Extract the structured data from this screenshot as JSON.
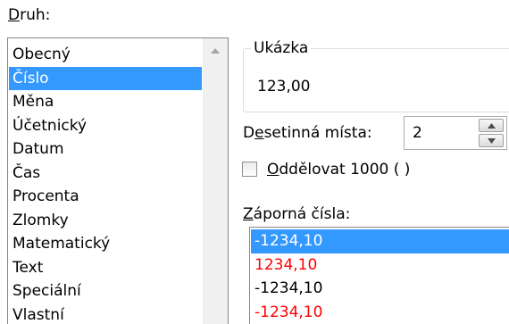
{
  "category": {
    "label_prefix": "",
    "label_accel": "D",
    "label_rest": "ruh:",
    "items": [
      "Obecný",
      "Číslo",
      "Měna",
      "Účetnický",
      "Datum",
      "Čas",
      "Procenta",
      "Zlomky",
      "Matematický",
      "Text",
      "Speciální",
      "Vlastní"
    ],
    "selected_index": 1
  },
  "sample": {
    "legend": "Ukázka",
    "value": "123,00"
  },
  "decimals": {
    "label_prefix": "D",
    "label_accel": "e",
    "label_rest": "setinná místa:",
    "value": "2"
  },
  "thousands": {
    "label_prefix": "",
    "label_accel": "O",
    "label_rest": "ddělovat 1000 ( )",
    "checked": false
  },
  "negative": {
    "label_prefix": "",
    "label_accel": "Z",
    "label_rest": "áporná čísla:",
    "items": [
      {
        "text": "-1234,10",
        "color": "selected"
      },
      {
        "text": "1234,10",
        "color": "red"
      },
      {
        "text": "-1234,10",
        "color": "black"
      },
      {
        "text": "-1234,10",
        "color": "red"
      }
    ],
    "selected_index": 0
  },
  "colors": {
    "selection": "#3399ff",
    "negative_red": "#ff0000"
  }
}
